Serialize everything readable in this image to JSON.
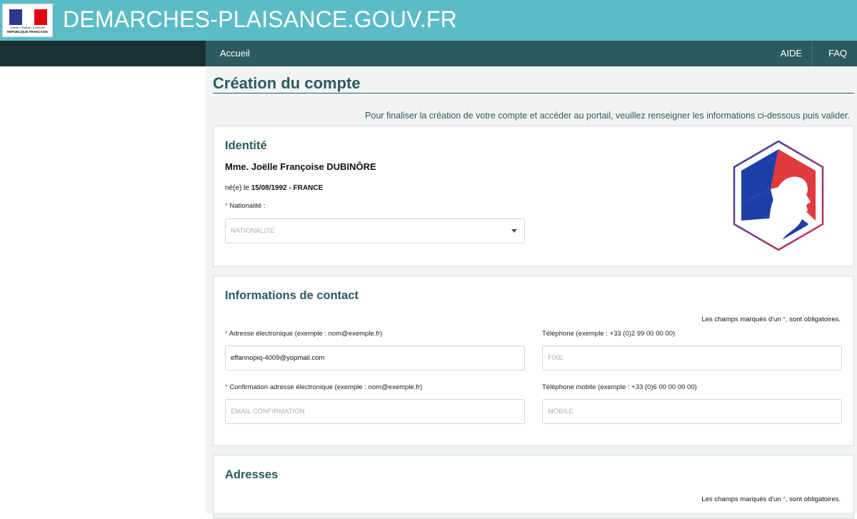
{
  "header": {
    "site_title": "DEMARCHES-PLAISANCE.GOUV.FR",
    "logo": {
      "motto": "Liberté • Égalité • Fraternité",
      "country": "RÉPUBLIQUE FRANÇAISE"
    }
  },
  "nav": {
    "home": "Accueil",
    "aide": "AIDE",
    "faq": "FAQ"
  },
  "page": {
    "title": "Création du compte",
    "intro": "Pour finaliser la création de votre compte et accéder au portail, veuillez renseigner les informations ci-dessous puis valider."
  },
  "identity": {
    "title": "Identité",
    "person": "Mme. Joëlle Françoise DUBINÔRE",
    "born_prefix": "né(e) le",
    "born_value": "15/08/1992 - FRANCE",
    "nationality_label": "Nationalité :",
    "nationality_placeholder": "NATIONALITE"
  },
  "contact": {
    "title": "Informations de contact",
    "mandatory_before": "Les champs marqués d'un",
    "mandatory_star": "*",
    "mandatory_after": ", sont obligatoires.",
    "email_label": "Adresse électronique (exemple : nom@exemple.fr)",
    "email_value": "effannopiq-4009@yopmail.com",
    "email_confirm_label": "Confirmation adresse électronique (exemple : nom@exemple.fr)",
    "email_confirm_placeholder": "EMAIL CONFIRMATION",
    "phone_label": "Téléphone (exemple : +33 (0)2 99 00 00 00)",
    "phone_placeholder": "FIXE",
    "mobile_label": "Téléphone mobile (exemple : +33 (0)6 00 00 00 00)",
    "mobile_placeholder": "MOBILE"
  },
  "addresses": {
    "title": "Adresses",
    "mandatory_before": "Les champs marqués d'un",
    "mandatory_star": "*",
    "mandatory_after": ", sont obligatoires."
  },
  "required_marker": "*",
  "colors": {
    "header": "#5bbcc7",
    "nav": "#2c5a5f",
    "sidebar": "#1a3134",
    "accent": "#2c5a5f",
    "required": "#e2463c"
  }
}
